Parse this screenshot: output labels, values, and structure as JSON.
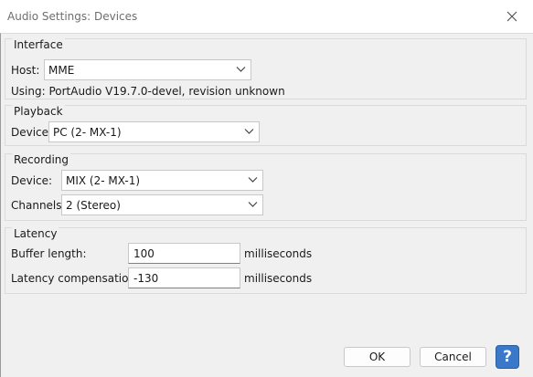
{
  "window": {
    "title": "Audio Settings: Devices"
  },
  "interface": {
    "group_label": "Interface",
    "host_label": "Host:",
    "host_value": "MME",
    "info": "Using: PortAudio V19.7.0-devel, revision unknown"
  },
  "playback": {
    "group_label": "Playback",
    "device_label": "Device:",
    "device_value": "PC (2- MX-1)"
  },
  "recording": {
    "group_label": "Recording",
    "device_label": "Device:",
    "device_value": "MIX (2- MX-1)",
    "channels_label": "Channels:",
    "channels_value": "2 (Stereo)"
  },
  "latency": {
    "group_label": "Latency",
    "buffer_label": "Buffer length:",
    "buffer_value": "100",
    "buffer_unit": "milliseconds",
    "comp_label": "Latency compensation:",
    "comp_value": "-130",
    "comp_unit": "milliseconds"
  },
  "buttons": {
    "ok": "OK",
    "cancel": "Cancel",
    "help": "?"
  },
  "colors": {
    "accent": "#3a78c9",
    "background": "#f0f0f0"
  }
}
